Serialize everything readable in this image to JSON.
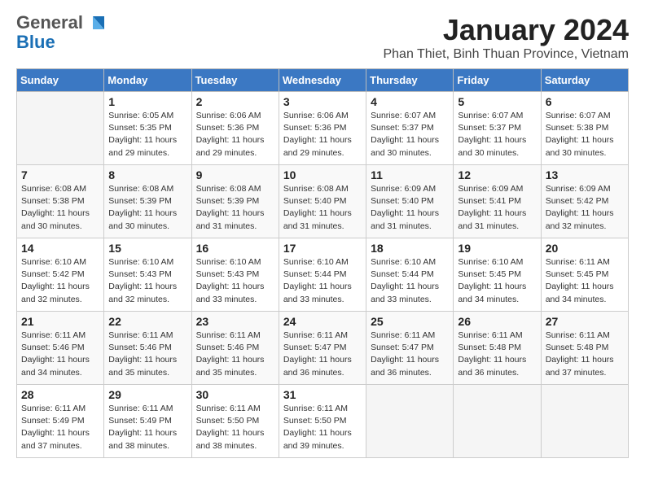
{
  "header": {
    "logo_general": "General",
    "logo_blue": "Blue",
    "month_title": "January 2024",
    "subtitle": "Phan Thiet, Binh Thuan Province, Vietnam"
  },
  "days_of_week": [
    "Sunday",
    "Monday",
    "Tuesday",
    "Wednesday",
    "Thursday",
    "Friday",
    "Saturday"
  ],
  "weeks": [
    [
      {
        "num": "",
        "detail": ""
      },
      {
        "num": "1",
        "detail": "Sunrise: 6:05 AM\nSunset: 5:35 PM\nDaylight: 11 hours and 29 minutes."
      },
      {
        "num": "2",
        "detail": "Sunrise: 6:06 AM\nSunset: 5:36 PM\nDaylight: 11 hours and 29 minutes."
      },
      {
        "num": "3",
        "detail": "Sunrise: 6:06 AM\nSunset: 5:36 PM\nDaylight: 11 hours and 29 minutes."
      },
      {
        "num": "4",
        "detail": "Sunrise: 6:07 AM\nSunset: 5:37 PM\nDaylight: 11 hours and 30 minutes."
      },
      {
        "num": "5",
        "detail": "Sunrise: 6:07 AM\nSunset: 5:37 PM\nDaylight: 11 hours and 30 minutes."
      },
      {
        "num": "6",
        "detail": "Sunrise: 6:07 AM\nSunset: 5:38 PM\nDaylight: 11 hours and 30 minutes."
      }
    ],
    [
      {
        "num": "7",
        "detail": "Sunrise: 6:08 AM\nSunset: 5:38 PM\nDaylight: 11 hours and 30 minutes."
      },
      {
        "num": "8",
        "detail": "Sunrise: 6:08 AM\nSunset: 5:39 PM\nDaylight: 11 hours and 30 minutes."
      },
      {
        "num": "9",
        "detail": "Sunrise: 6:08 AM\nSunset: 5:39 PM\nDaylight: 11 hours and 31 minutes."
      },
      {
        "num": "10",
        "detail": "Sunrise: 6:08 AM\nSunset: 5:40 PM\nDaylight: 11 hours and 31 minutes."
      },
      {
        "num": "11",
        "detail": "Sunrise: 6:09 AM\nSunset: 5:40 PM\nDaylight: 11 hours and 31 minutes."
      },
      {
        "num": "12",
        "detail": "Sunrise: 6:09 AM\nSunset: 5:41 PM\nDaylight: 11 hours and 31 minutes."
      },
      {
        "num": "13",
        "detail": "Sunrise: 6:09 AM\nSunset: 5:42 PM\nDaylight: 11 hours and 32 minutes."
      }
    ],
    [
      {
        "num": "14",
        "detail": "Sunrise: 6:10 AM\nSunset: 5:42 PM\nDaylight: 11 hours and 32 minutes."
      },
      {
        "num": "15",
        "detail": "Sunrise: 6:10 AM\nSunset: 5:43 PM\nDaylight: 11 hours and 32 minutes."
      },
      {
        "num": "16",
        "detail": "Sunrise: 6:10 AM\nSunset: 5:43 PM\nDaylight: 11 hours and 33 minutes."
      },
      {
        "num": "17",
        "detail": "Sunrise: 6:10 AM\nSunset: 5:44 PM\nDaylight: 11 hours and 33 minutes."
      },
      {
        "num": "18",
        "detail": "Sunrise: 6:10 AM\nSunset: 5:44 PM\nDaylight: 11 hours and 33 minutes."
      },
      {
        "num": "19",
        "detail": "Sunrise: 6:10 AM\nSunset: 5:45 PM\nDaylight: 11 hours and 34 minutes."
      },
      {
        "num": "20",
        "detail": "Sunrise: 6:11 AM\nSunset: 5:45 PM\nDaylight: 11 hours and 34 minutes."
      }
    ],
    [
      {
        "num": "21",
        "detail": "Sunrise: 6:11 AM\nSunset: 5:46 PM\nDaylight: 11 hours and 34 minutes."
      },
      {
        "num": "22",
        "detail": "Sunrise: 6:11 AM\nSunset: 5:46 PM\nDaylight: 11 hours and 35 minutes."
      },
      {
        "num": "23",
        "detail": "Sunrise: 6:11 AM\nSunset: 5:46 PM\nDaylight: 11 hours and 35 minutes."
      },
      {
        "num": "24",
        "detail": "Sunrise: 6:11 AM\nSunset: 5:47 PM\nDaylight: 11 hours and 36 minutes."
      },
      {
        "num": "25",
        "detail": "Sunrise: 6:11 AM\nSunset: 5:47 PM\nDaylight: 11 hours and 36 minutes."
      },
      {
        "num": "26",
        "detail": "Sunrise: 6:11 AM\nSunset: 5:48 PM\nDaylight: 11 hours and 36 minutes."
      },
      {
        "num": "27",
        "detail": "Sunrise: 6:11 AM\nSunset: 5:48 PM\nDaylight: 11 hours and 37 minutes."
      }
    ],
    [
      {
        "num": "28",
        "detail": "Sunrise: 6:11 AM\nSunset: 5:49 PM\nDaylight: 11 hours and 37 minutes."
      },
      {
        "num": "29",
        "detail": "Sunrise: 6:11 AM\nSunset: 5:49 PM\nDaylight: 11 hours and 38 minutes."
      },
      {
        "num": "30",
        "detail": "Sunrise: 6:11 AM\nSunset: 5:50 PM\nDaylight: 11 hours and 38 minutes."
      },
      {
        "num": "31",
        "detail": "Sunrise: 6:11 AM\nSunset: 5:50 PM\nDaylight: 11 hours and 39 minutes."
      },
      {
        "num": "",
        "detail": ""
      },
      {
        "num": "",
        "detail": ""
      },
      {
        "num": "",
        "detail": ""
      }
    ]
  ]
}
